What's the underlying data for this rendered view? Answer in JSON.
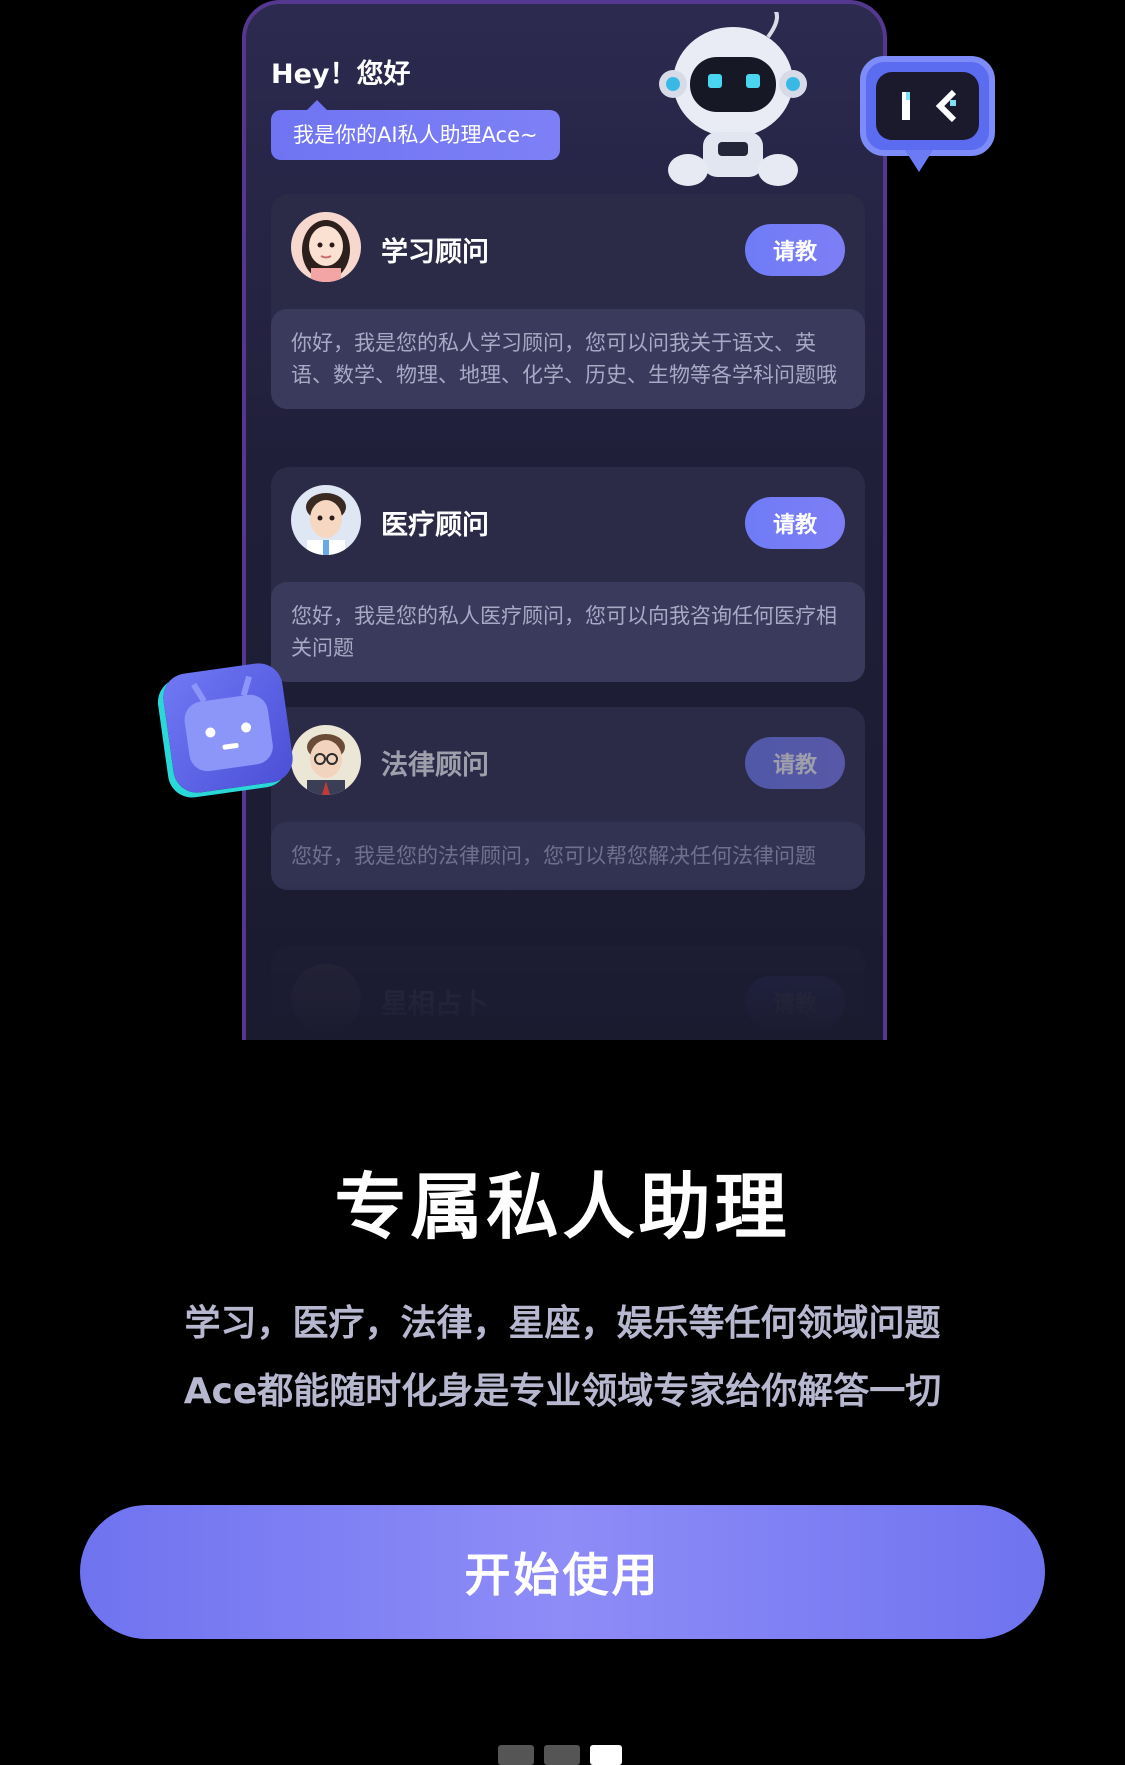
{
  "header": {
    "greeting": "Hey！您好",
    "intro_bubble": "我是你的AI私人助理Ace~"
  },
  "advisors": [
    {
      "title": "学习顾问",
      "button": "请教",
      "description": "你好，我是您的私人学习顾问，您可以问我关于语文、英语、数学、物理、地理、化学、历史、生物等各学科问题哦"
    },
    {
      "title": "医疗顾问",
      "button": "请教",
      "description": "您好，我是您的私人医疗顾问，您可以向我咨询任何医疗相关问题"
    },
    {
      "title": "法律顾问",
      "button": "请教",
      "description": "您好，我是您的法律顾问，您可以帮您解决任何法律问题"
    },
    {
      "title": "星相占卜",
      "button": "请教",
      "description": ""
    }
  ],
  "feature": {
    "headline": "专属私人助理",
    "subline_1": "学习，医疗，法律，星座，娱乐等任何领域问题",
    "subline_2": "Ace都能随时化身是专业领域专家给你解答一切"
  },
  "cta_label": "开始使用",
  "pagination": {
    "total": 3,
    "active": 3
  },
  "colors": {
    "accent": "#6f74f2",
    "card_bg": "#2b2b48",
    "desc_bg": "#393a5c"
  }
}
